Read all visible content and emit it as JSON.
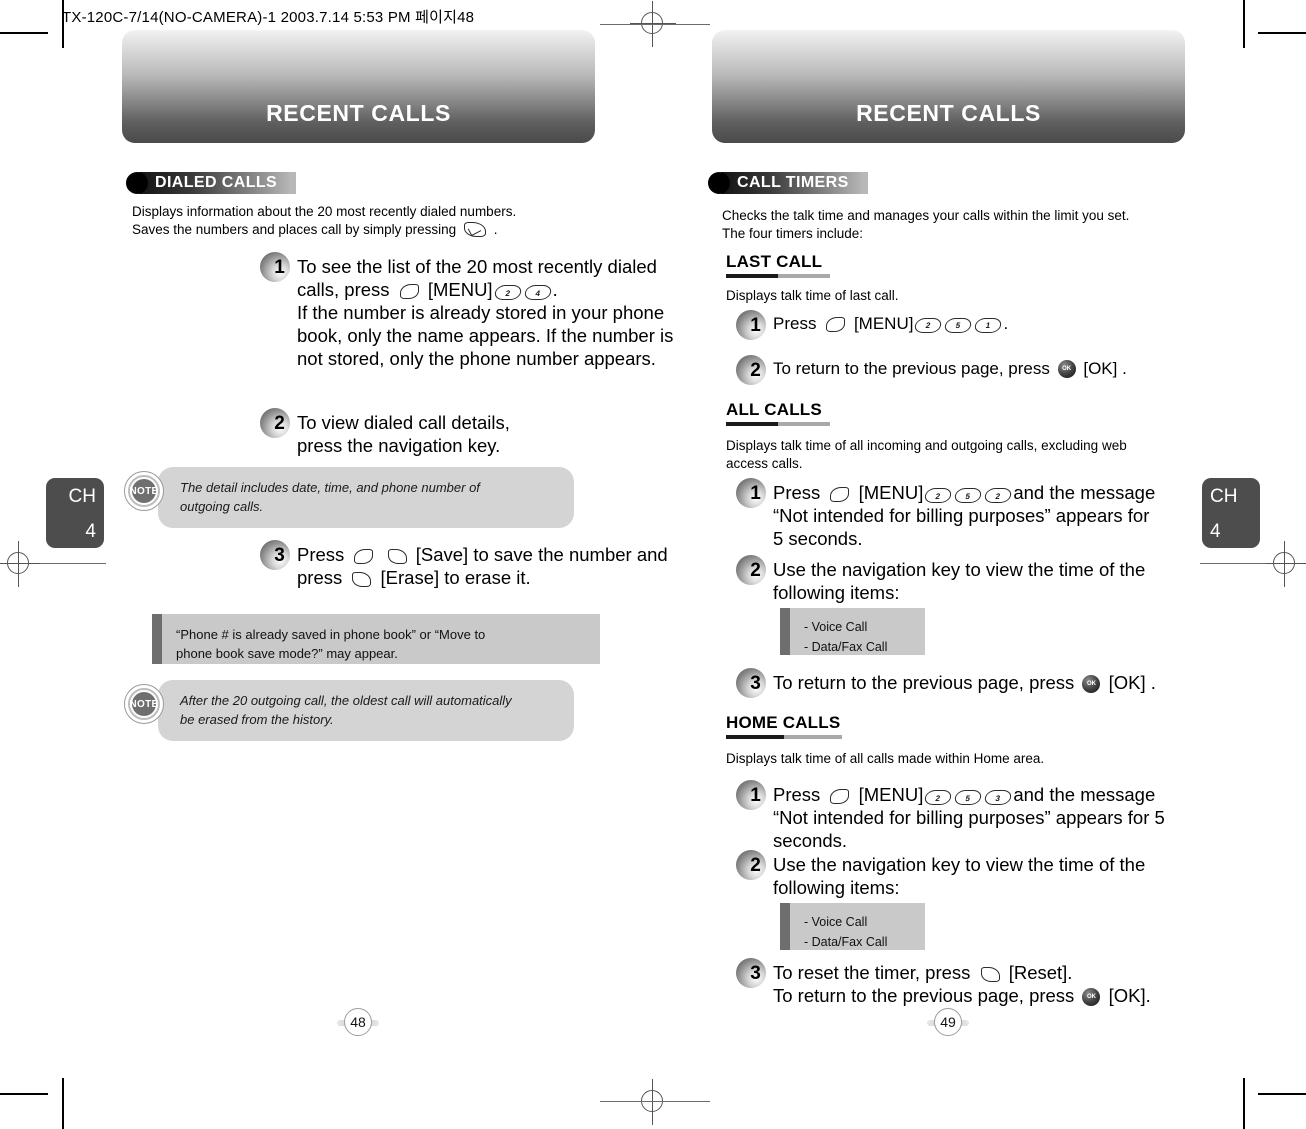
{
  "file_header": "TX-120C-7/14(NO-CAMERA)-1  2003.7.14 5:53 PM 페이지48",
  "chapter_tab": {
    "label": "CH",
    "number": "4"
  },
  "left_page": {
    "banner_title": "RECENT CALLS",
    "page_number": "48",
    "section": {
      "title": "DIALED CALLS"
    },
    "intro_line1": "Displays information about the 20 most recently dialed numbers.",
    "intro_line2_pre": "Saves the numbers and places call by simply pressing",
    "intro_line2_post": ".",
    "steps": [
      {
        "number": "1",
        "line1_pre": "To see the list of the 20 most recently dialed",
        "line2_pre": "calls, press",
        "line2_menu": "[MENU]",
        "line2_keys": [
          "2",
          "4"
        ],
        "line2_post": ".",
        "line3": "If the number is already stored in your phone",
        "line4": "book, only the name appears. If the number is",
        "line5": "not stored, only the phone number appears."
      },
      {
        "number": "2",
        "line1": "To view dialed call details,",
        "line2": "press the navigation key."
      },
      {
        "number": "3",
        "line1_pre": "Press",
        "line1_save": "[Save]",
        "line1_post": "to save the number and",
        "line2_pre": "press",
        "line2_erase": "[Erase]",
        "line2_post": "to erase it."
      }
    ],
    "note1": {
      "badge": "NOTE",
      "line1": "The detail includes date, time, and phone number of",
      "line2": "outgoing calls."
    },
    "tip1": {
      "line1": "“Phone # is already saved in phone book” or “Move to",
      "line2": "phone book save mode?” may appear."
    },
    "note2": {
      "badge": "NOTE",
      "line1": "After the 20 outgoing call, the oldest call will automatically",
      "line2": "be erased from the history."
    }
  },
  "right_page": {
    "banner_title": "RECENT CALLS",
    "page_number": "49",
    "section": {
      "title": "CALL TIMERS"
    },
    "intro_line1": "Checks the talk time and manages your calls within the limit you set.",
    "intro_line2": "The four timers include:",
    "subsections": [
      {
        "heading": "LAST CALL",
        "desc_line1": "Displays talk time of last call.",
        "desc_line2": "",
        "steps": [
          {
            "number": "1",
            "line1_pre": "Press",
            "menu": "[MENU]",
            "keys": [
              "2",
              "5",
              "1"
            ],
            "line1_post": "."
          },
          {
            "number": "2",
            "line1_pre": "To return to the previous page, press",
            "ok": "[OK]",
            "line1_post": "."
          }
        ]
      },
      {
        "heading": "ALL CALLS",
        "desc_line1": "Displays talk time of all incoming and outgoing calls, excluding web",
        "desc_line2": "access calls.",
        "steps": [
          {
            "number": "1",
            "line1_pre": "Press",
            "menu": "[MENU]",
            "keys": [
              "2",
              "5",
              "2"
            ],
            "line1_post": "and the message",
            "line2": "“Not intended for billing purposes” appears for",
            "line3": "5 seconds."
          },
          {
            "number": "2",
            "line1": "Use the navigation key to view the time of the",
            "line2": "following items:",
            "items": [
              "- Voice Call",
              "- Data/Fax Call"
            ]
          },
          {
            "number": "3",
            "line1_pre": "To return to the previous page, press",
            "ok": "[OK]",
            "line1_post": "."
          }
        ]
      },
      {
        "heading": "HOME CALLS",
        "desc_line1": "Displays talk time of all calls made within Home area.",
        "desc_line2": "",
        "steps": [
          {
            "number": "1",
            "line1_pre": "Press",
            "menu": "[MENU]",
            "keys": [
              "2",
              "5",
              "3"
            ],
            "line1_post": "and the message",
            "line2": "“Not intended for billing purposes” appears for 5",
            "line3": "seconds."
          },
          {
            "number": "2",
            "line1": "Use the navigation key to view the time of the",
            "line2": "following items:",
            "items": [
              "- Voice Call",
              "- Data/Fax Call"
            ]
          },
          {
            "number": "3",
            "line1_pre": "To reset the timer, press",
            "reset": "[Reset].",
            "line2_pre": "To return to the previous page, press",
            "ok": "[OK]."
          }
        ]
      }
    ]
  }
}
